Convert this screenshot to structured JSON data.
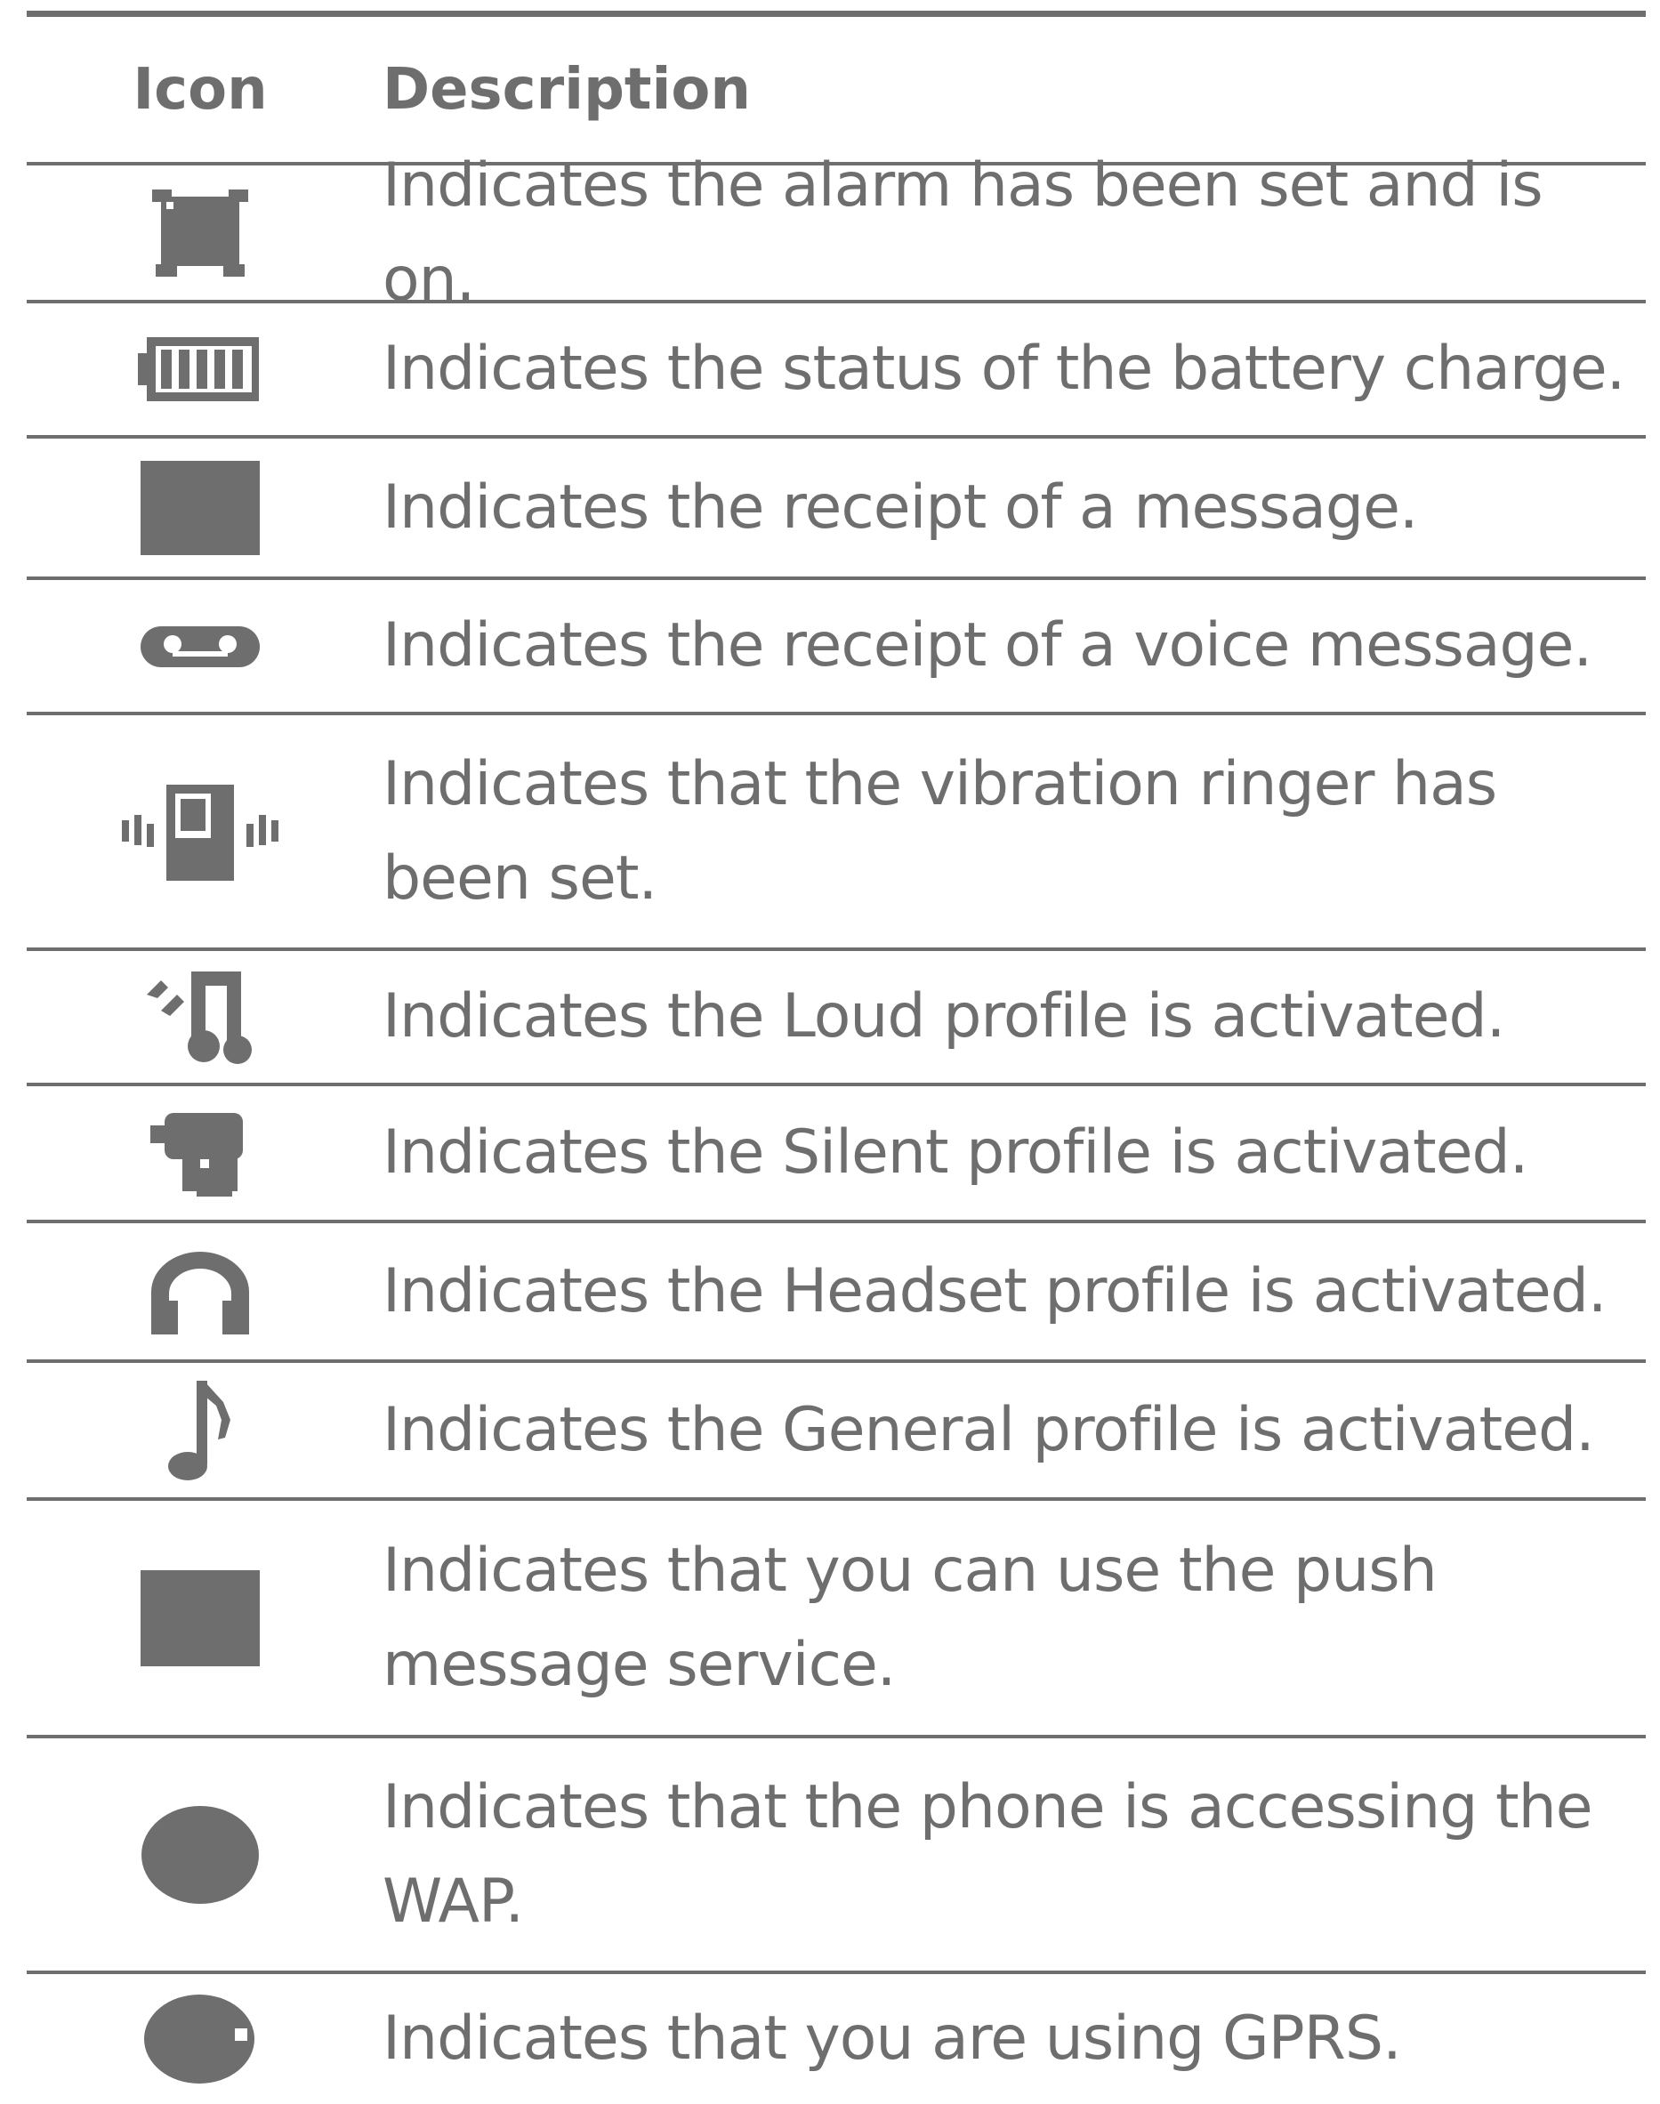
{
  "table": {
    "header": {
      "icon": "Icon",
      "description": "Description"
    },
    "rows": [
      {
        "icon": "alarm-clock-icon",
        "description": "Indicates the alarm has been set and is on."
      },
      {
        "icon": "battery-icon",
        "description": "Indicates the status of the battery charge."
      },
      {
        "icon": "message-icon",
        "description": "Indicates the receipt of a message."
      },
      {
        "icon": "voicemail-icon",
        "description": "Indicates the receipt of a voice message."
      },
      {
        "icon": "vibration-icon",
        "description": "Indicates that the vibration ringer has\nbeen set."
      },
      {
        "icon": "loud-profile-icon",
        "description": "Indicates the Loud profile is activated."
      },
      {
        "icon": "silent-profile-icon",
        "description": "Indicates the Silent profile is activated."
      },
      {
        "icon": "headset-icon",
        "description": "Indicates the Headset profile is activated."
      },
      {
        "icon": "music-note-icon",
        "description": "Indicates the General profile is activated."
      },
      {
        "icon": "push-message-icon",
        "description": "Indicates that you can use the push\nmessage service."
      },
      {
        "icon": "wap-icon",
        "description": "Indicates that the phone is accessing the\nWAP."
      },
      {
        "icon": "gprs-icon",
        "description": "Indicates that you are using GPRS."
      }
    ]
  },
  "colors": {
    "ink": "#6e6e6e",
    "background": "#ffffff"
  }
}
